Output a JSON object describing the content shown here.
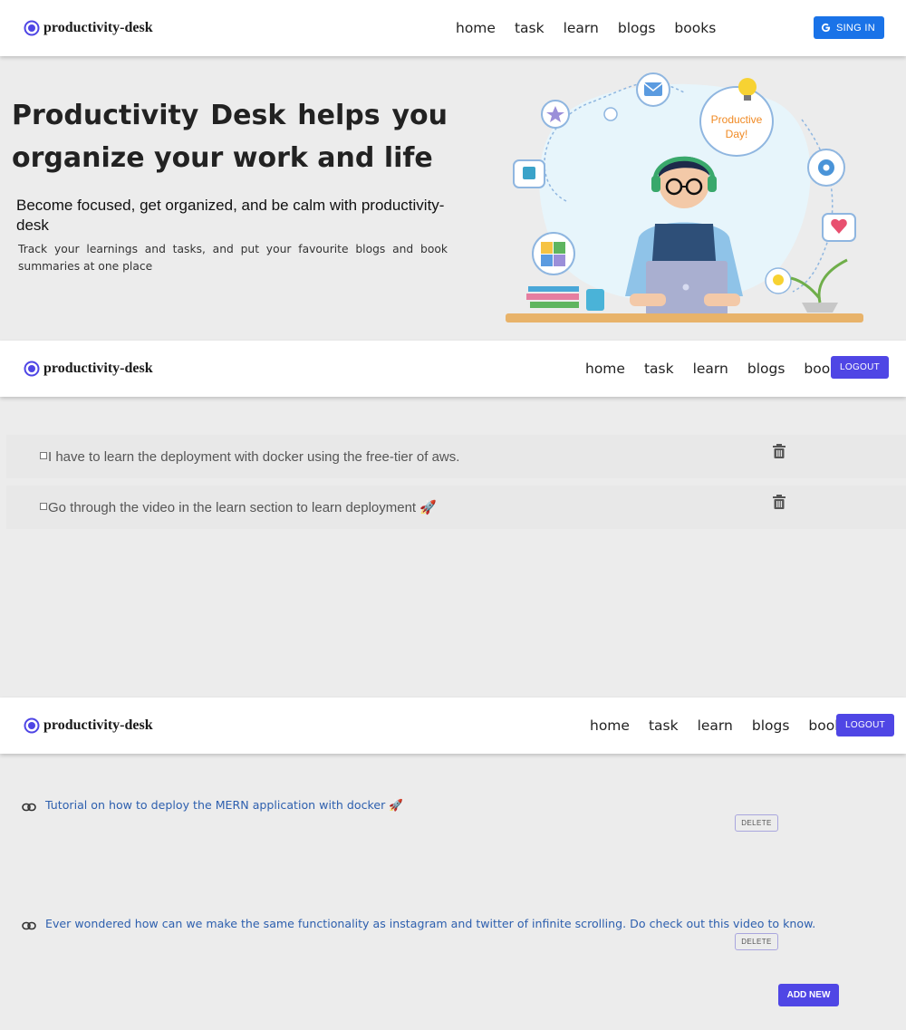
{
  "brand": {
    "name": "productivity-desk"
  },
  "nav": {
    "links": [
      "home",
      "task",
      "learn",
      "blogs",
      "books"
    ]
  },
  "signin": {
    "label": "SING IN"
  },
  "logout": {
    "label": "LOGOUT"
  },
  "hero": {
    "title": "Productivity Desk helps you organize your work and life",
    "subtitle": "Become focused, get organized, and be calm with productivity-desk",
    "description": "Track your learnings and tasks, and put your favourite blogs and book summaries at one place",
    "illustration_text": "Productive Day!"
  },
  "tasks": [
    {
      "text": "I have to learn the deployment with docker using the free-tier of aws."
    },
    {
      "text": "Go through the video in the learn section to learn deployment 🚀"
    }
  ],
  "learn": {
    "items": [
      {
        "text": "Tutorial on how to deploy the MERN application with docker 🚀",
        "delete_label": "DELETE"
      },
      {
        "text": "Ever wondered how can we make the same functionality as instagram and twitter of infinite scrolling. Do check out this video to know.",
        "delete_label": "DELETE"
      }
    ],
    "add_label": "ADD NEW"
  },
  "colors": {
    "accent": "#4f46e5",
    "google": "#1a73e8",
    "link": "#2d5fae"
  },
  "icons": [
    "productivity-logo-icon",
    "google-icon",
    "checkbox-icon",
    "trash-icon",
    "link-icon"
  ]
}
